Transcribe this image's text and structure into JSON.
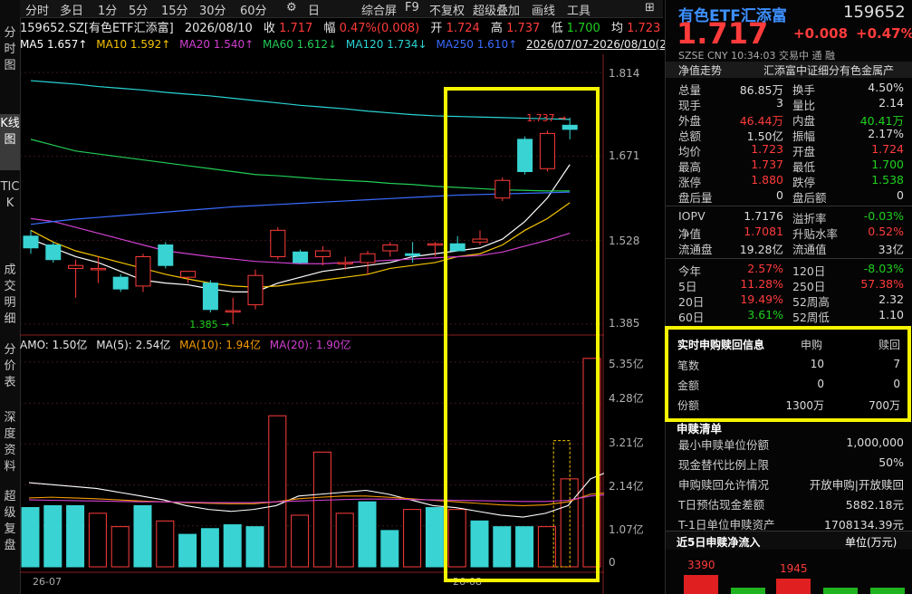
{
  "sidebar": {
    "tabs": [
      "分时图",
      "K线图",
      "TICK",
      "成交明细",
      "分价表",
      "深度资料",
      "超级复盘"
    ],
    "active": 1
  },
  "toolbar": {
    "items": [
      "分时",
      "多日",
      "1分",
      "5分",
      "15分",
      "30分",
      "60分",
      "⚙",
      "日"
    ],
    "right_items": [
      "综合屏",
      "F9",
      "不复权",
      "超级叠加",
      "画线",
      "工具",
      "⊞"
    ]
  },
  "info": {
    "code": "159652.SZ[有色ETF汇添富]",
    "date": "2026/08/10",
    "close_label": "收",
    "close": "1.717",
    "amp_label": "幅",
    "amp": "0.47%(0.008)",
    "open_label": "开",
    "open": "1.724",
    "high_label": "高",
    "high": "1.737",
    "low_label": "低",
    "low": "1.700",
    "avg_label": "均",
    "avg": "1.723",
    "more": "量"
  },
  "ma": {
    "ma5": "MA5 1.657↑",
    "ma10": "MA10 1.592↑",
    "ma20": "MA20 1.540↑",
    "ma60": "MA60 1.612↓",
    "ma120": "MA120 1.734↓",
    "ma250": "MA250 1.610↑",
    "range": "2026/07/07-2026/08/10(25日)"
  },
  "vol": {
    "amo": "AMO: 1.50亿",
    "ma5": "MA(5): 2.54亿",
    "ma10": "MA(10): 1.94亿",
    "ma20": "MA(20): 1.90亿"
  },
  "colors": {
    "up": "#ff3b3b",
    "down": "#39d3d3",
    "ma5": "#ffffff",
    "ma10": "#f5c400",
    "ma20": "#d040d0",
    "ma60": "#22cc55",
    "ma120": "#2ad4d4",
    "ma250": "#3a6cff",
    "highlight": "#f5f500"
  },
  "price_axis": [
    "1.814",
    "1.671",
    "1.528",
    "1.385"
  ],
  "vol_axis": [
    "5.35亿",
    "4.28亿",
    "3.21亿",
    "2.14亿",
    "1.07亿",
    "0"
  ],
  "date_axis": [
    "26-07",
    "26-08"
  ],
  "markers": {
    "high": "1.737",
    "low": "1.385"
  },
  "chart_data": {
    "type": "candlestick",
    "title": "",
    "ylim": [
      1.385,
      1.814
    ],
    "candles": [
      {
        "o": 1.535,
        "h": 1.545,
        "l": 1.505,
        "c": 1.515
      },
      {
        "o": 1.52,
        "h": 1.525,
        "l": 1.49,
        "c": 1.495
      },
      {
        "o": 1.48,
        "h": 1.495,
        "l": 1.43,
        "c": 1.485
      },
      {
        "o": 1.48,
        "h": 1.5,
        "l": 1.455,
        "c": 1.48
      },
      {
        "o": 1.465,
        "h": 1.47,
        "l": 1.44,
        "c": 1.445
      },
      {
        "o": 1.45,
        "h": 1.505,
        "l": 1.44,
        "c": 1.5
      },
      {
        "o": 1.52,
        "h": 1.525,
        "l": 1.48,
        "c": 1.485
      },
      {
        "o": 1.465,
        "h": 1.475,
        "l": 1.455,
        "c": 1.475
      },
      {
        "o": 1.455,
        "h": 1.46,
        "l": 1.405,
        "c": 1.41
      },
      {
        "o": 1.408,
        "h": 1.43,
        "l": 1.385,
        "c": 1.408
      },
      {
        "o": 1.418,
        "h": 1.478,
        "l": 1.41,
        "c": 1.468
      },
      {
        "o": 1.5,
        "h": 1.55,
        "l": 1.495,
        "c": 1.545
      },
      {
        "o": 1.508,
        "h": 1.512,
        "l": 1.488,
        "c": 1.49
      },
      {
        "o": 1.5,
        "h": 1.518,
        "l": 1.485,
        "c": 1.51
      },
      {
        "o": 1.49,
        "h": 1.5,
        "l": 1.478,
        "c": 1.49
      },
      {
        "o": 1.49,
        "h": 1.51,
        "l": 1.47,
        "c": 1.505
      },
      {
        "o": 1.51,
        "h": 1.525,
        "l": 1.5,
        "c": 1.52
      },
      {
        "o": 1.505,
        "h": 1.525,
        "l": 1.49,
        "c": 1.502
      },
      {
        "o": 1.52,
        "h": 1.525,
        "l": 1.5,
        "c": 1.522
      },
      {
        "o": 1.522,
        "h": 1.535,
        "l": 1.515,
        "c": 1.51
      },
      {
        "o": 1.525,
        "h": 1.545,
        "l": 1.52,
        "c": 1.53
      },
      {
        "o": 1.6,
        "h": 1.635,
        "l": 1.595,
        "c": 1.63
      },
      {
        "o": 1.7,
        "h": 1.705,
        "l": 1.64,
        "c": 1.645
      },
      {
        "o": 1.65,
        "h": 1.715,
        "l": 1.645,
        "c": 1.71
      },
      {
        "o": 1.724,
        "h": 1.737,
        "l": 1.7,
        "c": 1.717
      }
    ],
    "volume": [
      1.55,
      1.6,
      1.6,
      1.4,
      1.05,
      1.6,
      1.2,
      0.85,
      1.0,
      1.1,
      1.05,
      3.95,
      1.35,
      3.0,
      1.4,
      1.7,
      0.95,
      1.5,
      1.55,
      1.5,
      1.2,
      1.05,
      1.05,
      1.05,
      2.3,
      5.45,
      2.5,
      1.5
    ],
    "ma_lines": {
      "ma5": [
        1.53,
        1.515,
        1.5,
        1.49,
        1.475,
        1.46,
        1.455,
        1.452,
        1.445,
        1.44,
        1.44,
        1.455,
        1.465,
        1.475,
        1.48,
        1.485,
        1.49,
        1.5,
        1.505,
        1.51,
        1.515,
        1.53,
        1.56,
        1.6,
        1.657
      ],
      "ma10": [
        1.545,
        1.525,
        1.51,
        1.5,
        1.49,
        1.48,
        1.47,
        1.462,
        1.455,
        1.45,
        1.448,
        1.45,
        1.455,
        1.46,
        1.465,
        1.47,
        1.48,
        1.485,
        1.49,
        1.5,
        1.505,
        1.52,
        1.545,
        1.565,
        1.592
      ],
      "ma20": [
        1.565,
        1.56,
        1.55,
        1.54,
        1.53,
        1.52,
        1.51,
        1.505,
        1.5,
        1.496,
        1.492,
        1.49,
        1.488,
        1.488,
        1.49,
        1.492,
        1.494,
        1.496,
        1.498,
        1.5,
        1.502,
        1.508,
        1.518,
        1.528,
        1.54
      ],
      "ma60": [
        1.7,
        1.69,
        1.68,
        1.675,
        1.67,
        1.665,
        1.66,
        1.655,
        1.65,
        1.645,
        1.64,
        1.638,
        1.635,
        1.632,
        1.63,
        1.628,
        1.625,
        1.623,
        1.62,
        1.618,
        1.616,
        1.614,
        1.613,
        1.612,
        1.612
      ],
      "ma120": [
        1.8,
        1.797,
        1.794,
        1.79,
        1.787,
        1.784,
        1.78,
        1.777,
        1.774,
        1.77,
        1.766,
        1.762,
        1.758,
        1.755,
        1.752,
        1.748,
        1.745,
        1.742,
        1.74,
        1.739,
        1.738,
        1.737,
        1.736,
        1.735,
        1.734
      ],
      "ma250": [
        1.555,
        1.56,
        1.564,
        1.567,
        1.57,
        1.573,
        1.576,
        1.579,
        1.582,
        1.585,
        1.587,
        1.589,
        1.591,
        1.593,
        1.595,
        1.597,
        1.599,
        1.601,
        1.603,
        1.605,
        1.606,
        1.607,
        1.608,
        1.609,
        1.61
      ]
    },
    "vol_ma": {
      "ma5": [
        2.2,
        2.15,
        2.1,
        2.05,
        1.95,
        1.85,
        1.75,
        1.6,
        1.5,
        1.45,
        1.5,
        1.6,
        1.85,
        1.9,
        1.95,
        2.0,
        1.9,
        1.75,
        1.6,
        1.55,
        1.45,
        1.35,
        1.3,
        1.4,
        1.6,
        2.3,
        2.54
      ],
      "ma10": [
        1.8,
        1.82,
        1.8,
        1.78,
        1.75,
        1.72,
        1.7,
        1.68,
        1.66,
        1.65,
        1.65,
        1.7,
        1.78,
        1.82,
        1.85,
        1.85,
        1.82,
        1.78,
        1.74,
        1.7,
        1.66,
        1.62,
        1.6,
        1.62,
        1.7,
        1.9,
        1.94
      ],
      "ma20": [
        1.75,
        1.74,
        1.73,
        1.72,
        1.71,
        1.7,
        1.7,
        1.69,
        1.68,
        1.68,
        1.68,
        1.7,
        1.72,
        1.74,
        1.76,
        1.77,
        1.77,
        1.76,
        1.75,
        1.74,
        1.73,
        1.72,
        1.71,
        1.71,
        1.74,
        1.85,
        1.9
      ]
    }
  },
  "quote": {
    "name": "有色ETF汇添富",
    "code": "159652",
    "price": "1.717",
    "change": "+0.008",
    "pct": "+0.47%",
    "sub": "SZSE  CNY  10:34:03  交易中  通  融"
  },
  "nav_trend": {
    "label": "净值走势",
    "desc": "汇添富中证细分有色金属产"
  },
  "stats": [
    [
      "总量",
      "86.85万",
      "换手",
      "4.50%"
    ],
    [
      "现手",
      "3",
      "量比",
      "2.14"
    ],
    [
      "外盘",
      "46.44万",
      "内盘",
      "40.41万"
    ],
    [
      "总额",
      "1.50亿",
      "振幅",
      "2.17%"
    ],
    [
      "均价",
      "1.723",
      "开盘",
      "1.724"
    ],
    [
      "最高",
      "1.737",
      "最低",
      "1.700"
    ],
    [
      "涨停",
      "1.880",
      "跌停",
      "1.538"
    ],
    [
      "盘后量",
      "0",
      "盘后额",
      "0"
    ]
  ],
  "stats2": [
    [
      "IOPV",
      "1.7176",
      "溢折率",
      "-0.03%"
    ],
    [
      "净值",
      "1.7081",
      "升贴水率",
      "0.52%"
    ],
    [
      "流通盘",
      "19.28亿",
      "流通值",
      "33亿"
    ]
  ],
  "perf": [
    [
      "今年",
      "2.57%",
      "120日",
      "-8.03%"
    ],
    [
      "5日",
      "11.28%",
      "250日",
      "57.38%"
    ],
    [
      "20日",
      "19.49%",
      "52周高",
      "2.32"
    ],
    [
      "60日",
      "3.61%",
      "52周低",
      "1.10"
    ]
  ],
  "subred": {
    "title": "实时申购赎回信息",
    "col1": "申购",
    "col2": "赎回",
    "rows": [
      [
        "笔数",
        "10",
        "7"
      ],
      [
        "金额",
        "0",
        "0"
      ],
      [
        "份额",
        "1300万",
        "700万"
      ]
    ]
  },
  "redeem_list": {
    "header": "申赎清单",
    "rows": [
      [
        "最小申赎单位份额",
        "1,000,000"
      ],
      [
        "现金替代比例上限",
        "50%"
      ],
      [
        "申购赎回允许情况",
        "开放申购|开放赎回"
      ],
      [
        "T日预估现金差额",
        "5882.18元"
      ],
      [
        "T-1日单位申赎资产",
        "1708134.39元"
      ]
    ]
  },
  "net_flow": {
    "title": "近5日申赎净流入",
    "unit": "单位(万元)",
    "labels": [
      "3390",
      "1945"
    ]
  }
}
